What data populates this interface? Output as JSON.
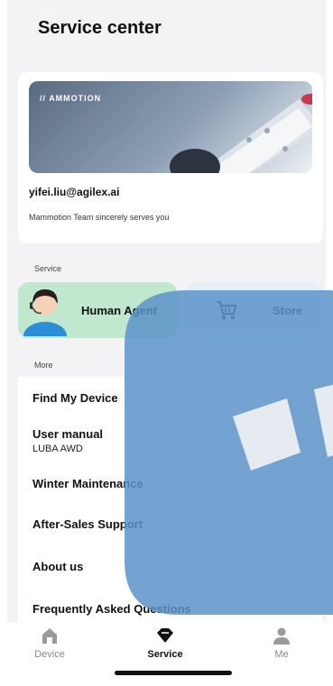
{
  "header": {
    "title": "Service center"
  },
  "profile": {
    "banner_brand": "AMMOTION",
    "email": "yifei.liu@agilex.ai",
    "tagline": "Mammotion Team sincerely serves you"
  },
  "service": {
    "section_label": "Service",
    "human_agent_label": "Human Agent",
    "store_label": "Store"
  },
  "more": {
    "section_label": "More",
    "items": [
      {
        "label": "Find My Device"
      },
      {
        "label": "User manual",
        "sub": "LUBA AWD"
      },
      {
        "label": "Winter Maintenance"
      },
      {
        "label": "After-Sales Support"
      },
      {
        "label": "About us"
      },
      {
        "label": "Frequently Asked Questions"
      }
    ]
  },
  "tabbar": {
    "tabs": [
      {
        "label": "Device",
        "icon": "device-icon",
        "active": false
      },
      {
        "label": "Service",
        "icon": "service-icon",
        "active": true
      },
      {
        "label": "Me",
        "icon": "me-icon",
        "active": false
      }
    ]
  },
  "colors": {
    "watermark": "#5c93c9",
    "agent_tile": "#bfe8cf",
    "store_tile": "#e8eef5"
  }
}
